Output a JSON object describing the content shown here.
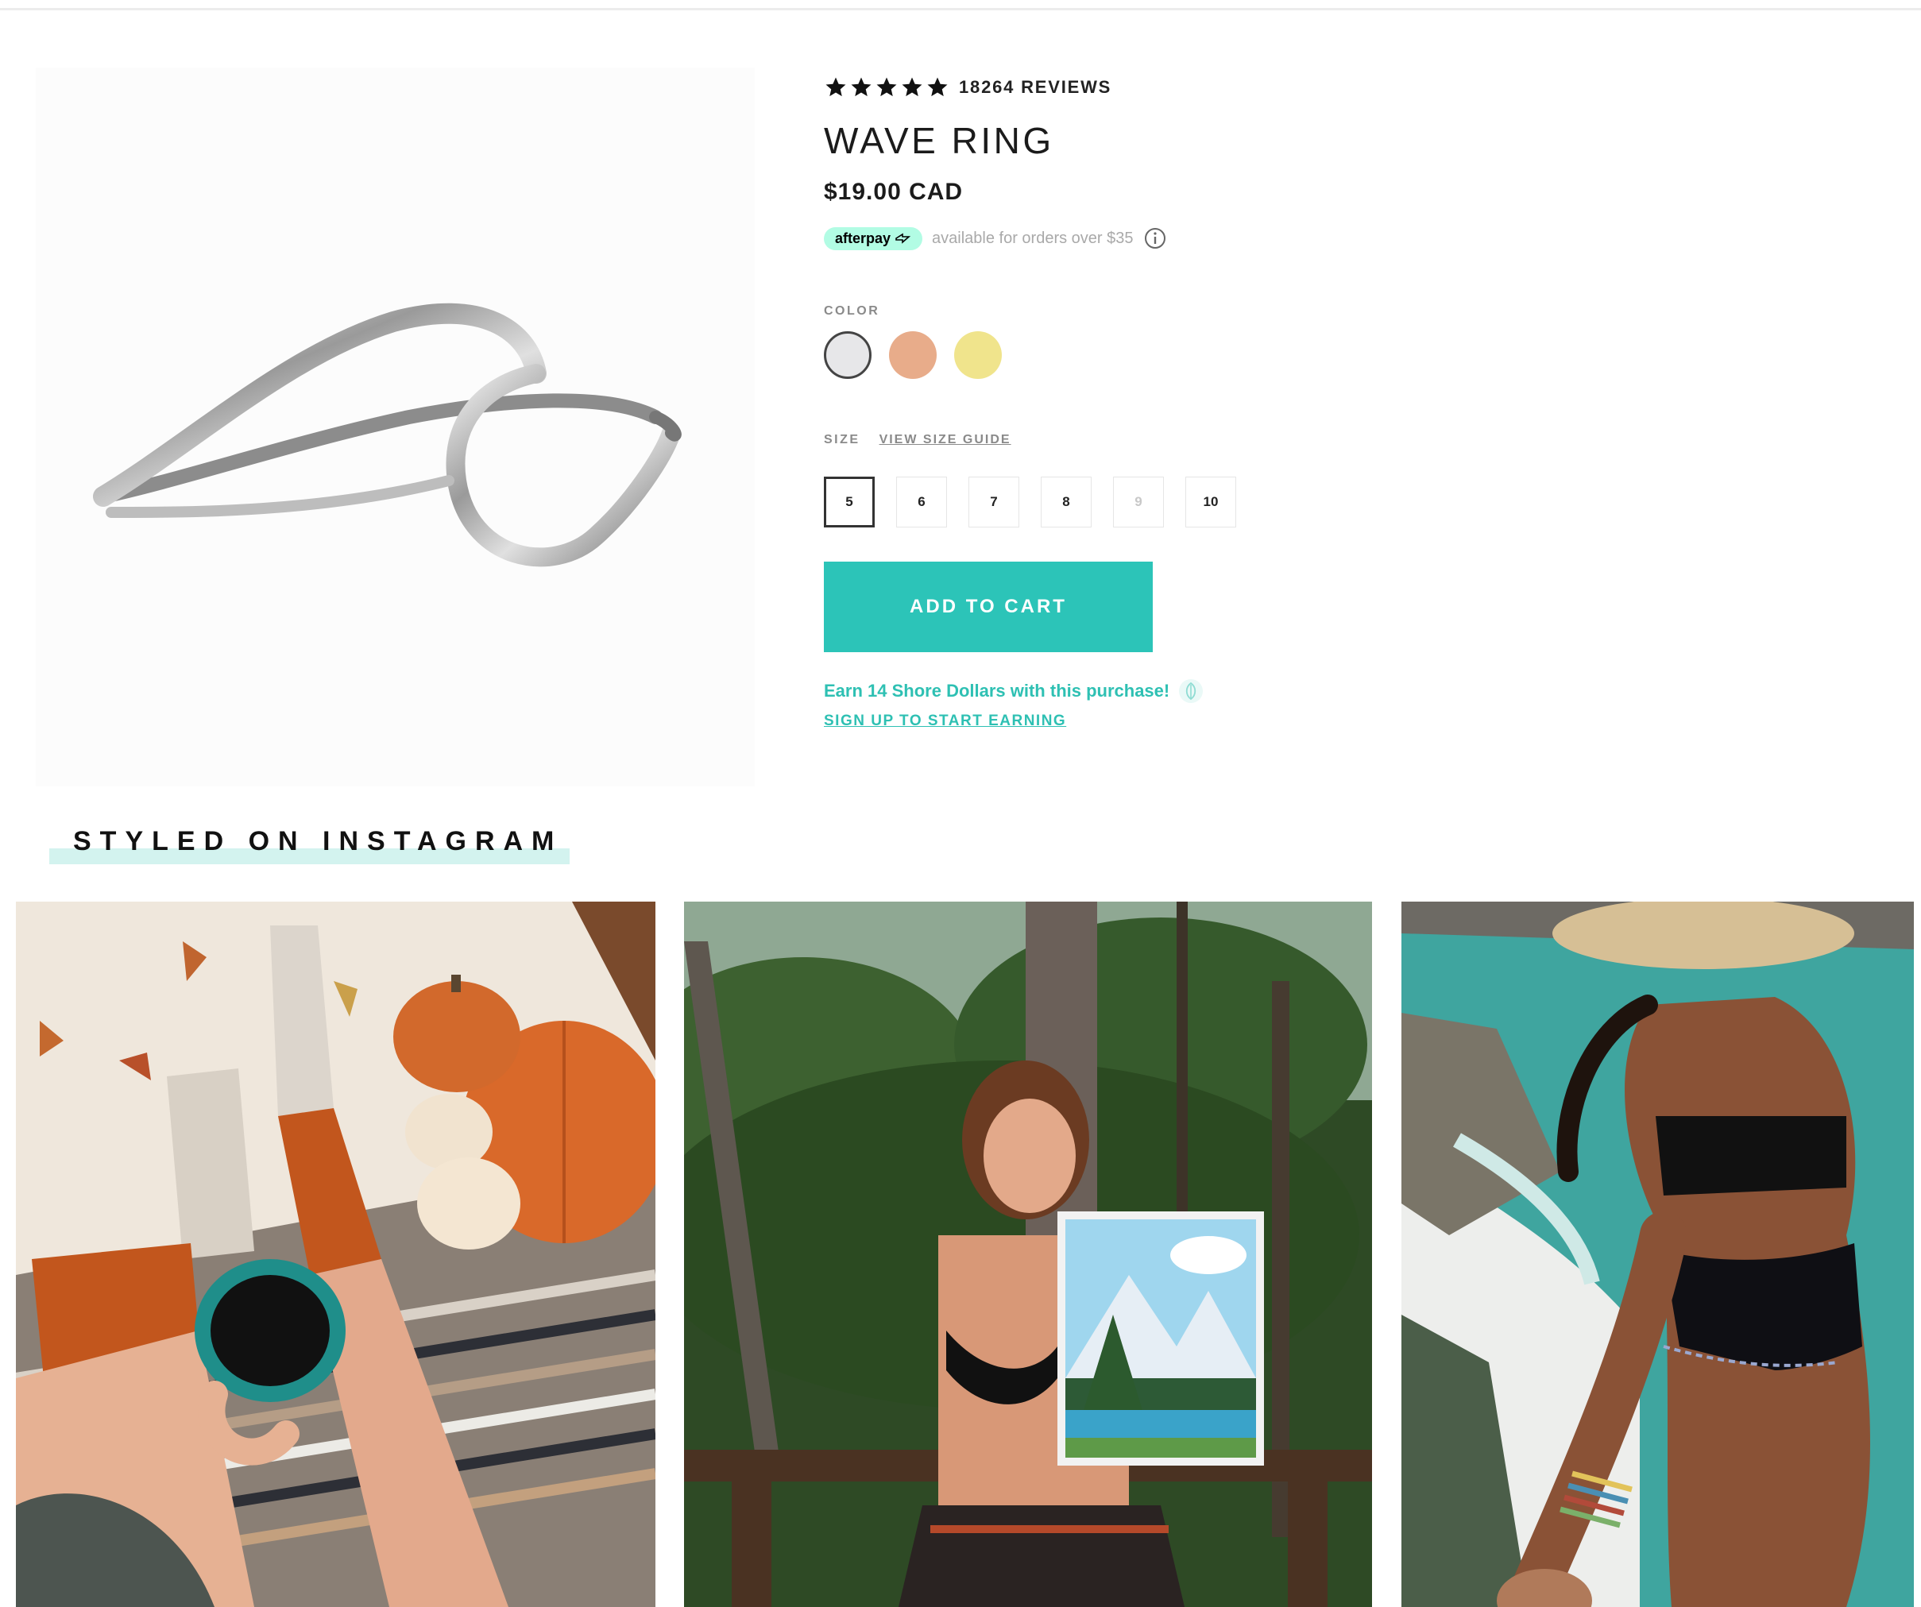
{
  "product": {
    "rating": {
      "stars": 5,
      "review_count": "18264 REVIEWS"
    },
    "title": "WAVE RING",
    "price": "$19.00 CAD",
    "afterpay": {
      "badge": "afterpay",
      "text": "available for orders over $35"
    },
    "color_label": "COLOR",
    "colors": [
      {
        "name": "silver",
        "hex": "#e7e7e9",
        "selected": true
      },
      {
        "name": "rose-gold",
        "hex": "#e8ac8a",
        "selected": false
      },
      {
        "name": "gold",
        "hex": "#f0e48c",
        "selected": false
      }
    ],
    "size_label": "SIZE",
    "size_guide": "VIEW SIZE GUIDE",
    "sizes": [
      {
        "label": "5",
        "selected": true,
        "available": true
      },
      {
        "label": "6",
        "selected": false,
        "available": true
      },
      {
        "label": "7",
        "selected": false,
        "available": true
      },
      {
        "label": "8",
        "selected": false,
        "available": true
      },
      {
        "label": "9",
        "selected": false,
        "available": false
      },
      {
        "label": "10",
        "selected": false,
        "available": true
      }
    ],
    "add_to_cart": "ADD TO CART",
    "earn_text": "Earn 14 Shore Dollars with this purchase!",
    "signup_text": "SIGN UP TO START EARNING"
  },
  "instagram": {
    "title": "STYLED ON INSTAGRAM"
  },
  "colors": {
    "accent": "#2cc4b8",
    "afterpay": "#b2fce4",
    "star": "#111111"
  }
}
